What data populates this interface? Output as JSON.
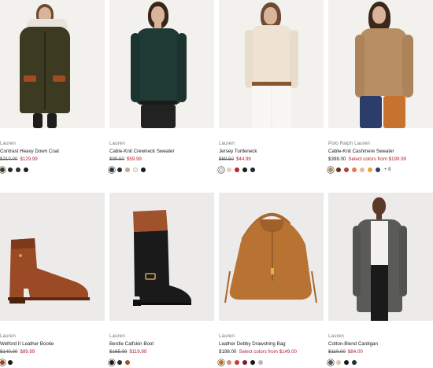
{
  "products": [
    {
      "brand": "Lauren",
      "name": "Contrast Heavy Down Coat",
      "old_price": "$210.00",
      "sale_price": "$129.99",
      "swatches": [
        "#3b3a22",
        "#2b2b2b",
        "#2a2d36",
        "#1d1d1d"
      ],
      "more": ""
    },
    {
      "brand": "Lauren",
      "name": "Cable-Knit Crewneck Sweater",
      "old_price": "$99.50",
      "sale_price": "$59.99",
      "swatches": [
        "#1f3a34",
        "#2c2c2c",
        "#c5a98a",
        "#f4f4f4",
        "#1a1a1a"
      ],
      "more": ""
    },
    {
      "brand": "Lauren",
      "name": "Jersey Turtleneck",
      "old_price": "$69.50",
      "sale_price": "$44.99",
      "swatches": [
        "#efe5d6",
        "#e7cbbd",
        "#b9272e",
        "#1a1a1a",
        "#1f2437"
      ],
      "more": ""
    },
    {
      "brand": "Polo Ralph Lauren",
      "name": "Cable-Knit Cashmere Sweater",
      "regular_price": "$398.00",
      "select_label": "Select colors from",
      "select_price": "$199.99",
      "swatches": [
        "#b88e63",
        "#5b3623",
        "#c1393d",
        "#e47b4e",
        "#e8b98e",
        "#e5a53b",
        "#2c3d6b"
      ],
      "more": "+ 8"
    },
    {
      "brand": "Lauren",
      "name": "Welford II Leather Bootie",
      "old_price": "$140.00",
      "sale_price": "$89.99",
      "swatches": [
        "#9a4a24",
        "#1a1a1a"
      ],
      "more": ""
    },
    {
      "brand": "Lauren",
      "name": "Berdie Calfskin Boot",
      "old_price": "$165.00",
      "sale_price": "$119.99",
      "swatches": [
        "#1a1a1a",
        "#2d2d2d",
        "#a0522d"
      ],
      "more": ""
    },
    {
      "brand": "Lauren",
      "name": "Leather Debby Drawstring Bag",
      "regular_price": "$198.00",
      "select_label": "Select colors from",
      "select_price": "$149.00",
      "swatches": [
        "#b87333",
        "#d98b7b",
        "#c23b3b",
        "#7a1f2b",
        "#1a1a1a",
        "#b7b9bd"
      ],
      "more": ""
    },
    {
      "brand": "Lauren",
      "name": "Cotton-Blend Cardigan",
      "old_price": "$110.00",
      "sale_price": "$84.00",
      "swatches": [
        "#5a5a58",
        "#d8c9b6",
        "#1a1a1a",
        "#2a2d3a"
      ],
      "more": ""
    }
  ]
}
